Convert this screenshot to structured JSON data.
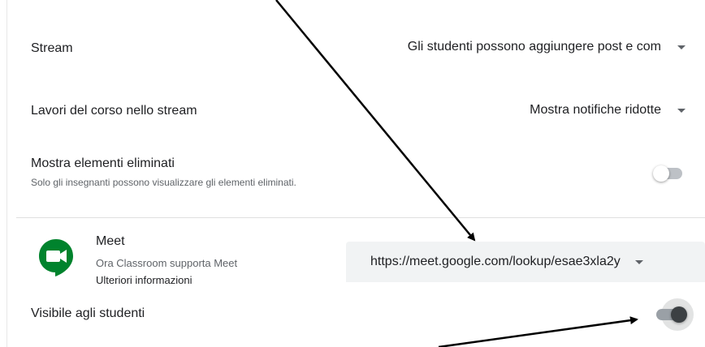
{
  "settings": {
    "stream": {
      "label": "Stream",
      "value": "Gli studenti possono aggiungere post e com"
    },
    "classwork_stream": {
      "label": "Lavori del corso nello stream",
      "value": "Mostra notifiche ridotte"
    },
    "show_deleted": {
      "label": "Mostra elementi eliminati",
      "description": "Solo gli insegnanti possono visualizzare gli elementi eliminati.",
      "enabled": false
    }
  },
  "meet": {
    "title": "Meet",
    "subtitle": "Ora Classroom supporta Meet",
    "link_label": "Ulteriori informazioni",
    "url": "https://meet.google.com/lookup/esae3xla2y",
    "visible_label": "Visibile agli studenti",
    "visible_enabled": true,
    "icon": "google-meet-icon"
  },
  "colors": {
    "meet_green": "#00832d",
    "toggle_on_thumb": "#3c4043",
    "toggle_off_track": "#bdc1c6",
    "field_bg": "#f1f3f4"
  }
}
